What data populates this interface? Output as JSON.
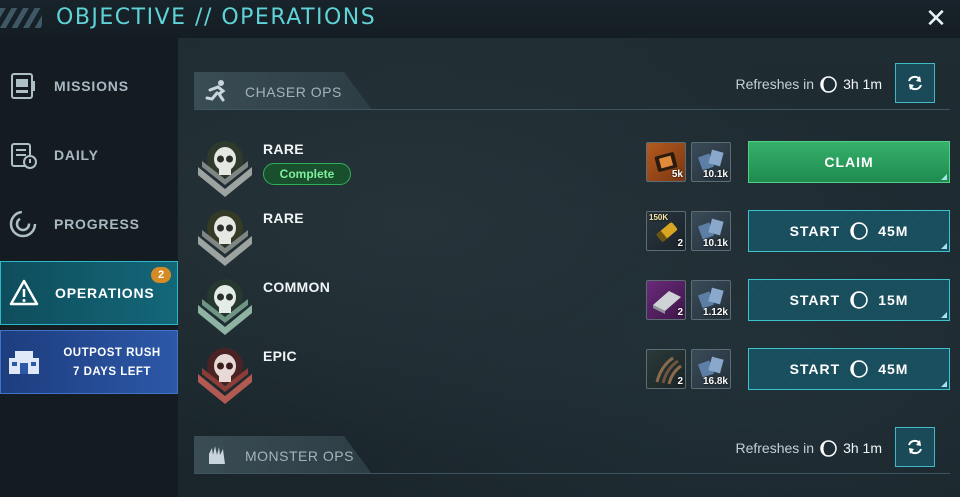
{
  "header": {
    "title": "OBJECTIVE // OPERATIONS"
  },
  "sidebar": {
    "items": [
      {
        "label": "MISSIONS",
        "icon": "missions-icon"
      },
      {
        "label": "DAILY",
        "icon": "daily-icon"
      },
      {
        "label": "PROGRESS",
        "icon": "progress-icon"
      },
      {
        "label": "OPERATIONS",
        "icon": "warning-triangle-icon",
        "badge": "2",
        "active": true
      }
    ],
    "event": {
      "line1": "OUTPOST RUSH",
      "line2": "7 DAYS LEFT",
      "icon": "outpost-icon"
    }
  },
  "chaser_ops": {
    "title": "CHASER OPS",
    "refresh_label": "Refreshes in",
    "refresh_time": "3h 1m",
    "rows": [
      {
        "rarity": "RARE",
        "status": "Complete",
        "rewards": [
          {
            "qty": "5k"
          },
          {
            "qty": "10.1k"
          }
        ],
        "action": "CLAIM",
        "timer": ""
      },
      {
        "rarity": "RARE",
        "rewards": [
          {
            "tag": "150K",
            "qty": "2"
          },
          {
            "qty": "10.1k"
          }
        ],
        "action": "START",
        "timer": "45M"
      },
      {
        "rarity": "COMMON",
        "rewards": [
          {
            "qty": "2"
          },
          {
            "qty": "1.12k"
          }
        ],
        "action": "START",
        "timer": "15M"
      },
      {
        "rarity": "EPIC",
        "rewards": [
          {
            "qty": "2"
          },
          {
            "qty": "16.8k"
          }
        ],
        "action": "START",
        "timer": "45M"
      }
    ]
  },
  "monster_ops": {
    "title": "MONSTER OPS",
    "refresh_label": "Refreshes in",
    "refresh_time": "3h 1m"
  },
  "colors": {
    "accent": "#5fd3d8",
    "claim_green": "#2fa563",
    "start_teal": "#1b4e5c",
    "event_blue": "#2d58a8",
    "badge_orange": "#d58a25"
  }
}
